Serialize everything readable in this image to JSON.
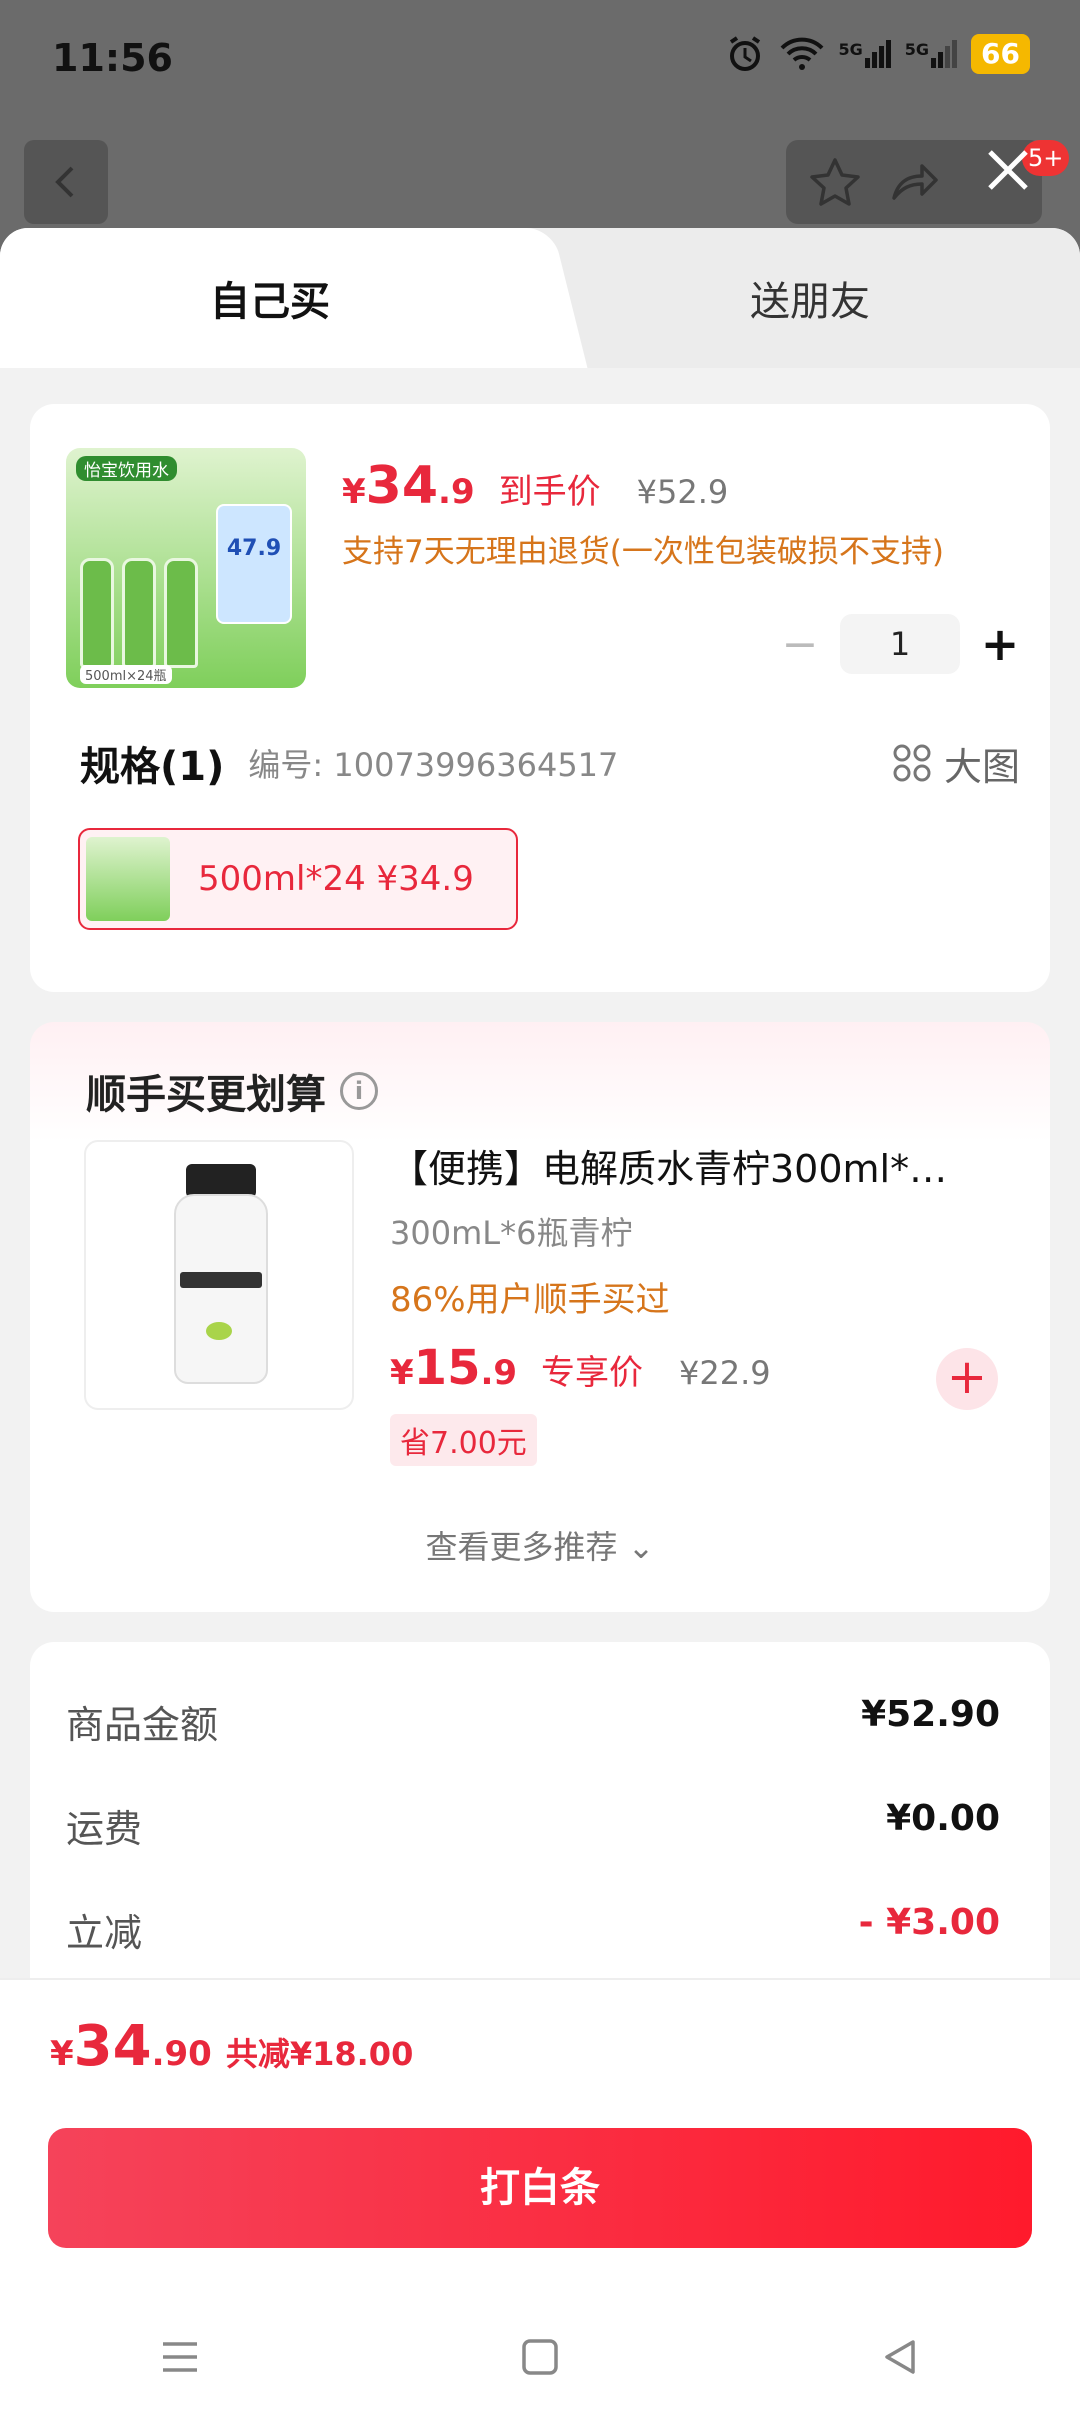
{
  "status": {
    "time": "11:56",
    "battery": "66",
    "signal1": "5G",
    "signal2": "5G"
  },
  "background": {
    "badge": "5+"
  },
  "tabs": {
    "self": "自己买",
    "gift": "送朋友"
  },
  "product": {
    "price_yen": "¥",
    "price_int": "34",
    "price_dec": ".9",
    "price_label": "到手价",
    "original_price": "¥52.9",
    "return_note": "支持7天无理由退货(一次性包装破损不支持)",
    "quantity": "1",
    "image_brand": "怡宝饮用水",
    "image_price": "47.9",
    "image_size": "500ml×24瓶"
  },
  "spec": {
    "title": "规格(1)",
    "code": "编号: 10073996364517",
    "big_image": "大图",
    "option_label": "500ml*24  ¥34.9"
  },
  "recommend": {
    "title": "顺手买更划算",
    "info_icon": "i",
    "name": "【便携】电解质水青柠300ml*…",
    "spec": "300mL*6瓶青柠",
    "percent": "86%用户顺手买过",
    "price_yen": "¥",
    "price_int": "15",
    "price_dec": ".9",
    "price_label": "专享价",
    "original_price": "¥22.9",
    "save": "省7.00元",
    "add": "+",
    "see_more": "查看更多推荐 ⌄"
  },
  "summary": {
    "goods_label": "商品金额",
    "goods_value": "¥52.90",
    "shipping_label": "运费",
    "shipping_value": "¥0.00",
    "discount_label": "立减",
    "discount_value": "- ¥3.00"
  },
  "checkout": {
    "total_yen": "¥",
    "total_int": "34",
    "total_dec": ".90",
    "total_discount": "共减¥18.00",
    "pay_button": "打白条"
  },
  "colors": {
    "accent": "#e8283c",
    "orange": "#d6751b"
  },
  "icons": [
    "alarm-icon",
    "wifi-icon",
    "signal-icon",
    "battery-icon",
    "back-icon",
    "star-icon",
    "share-icon",
    "close-icon",
    "grid-icon",
    "info-icon",
    "menu-icon",
    "home-icon",
    "back-nav-icon"
  ]
}
